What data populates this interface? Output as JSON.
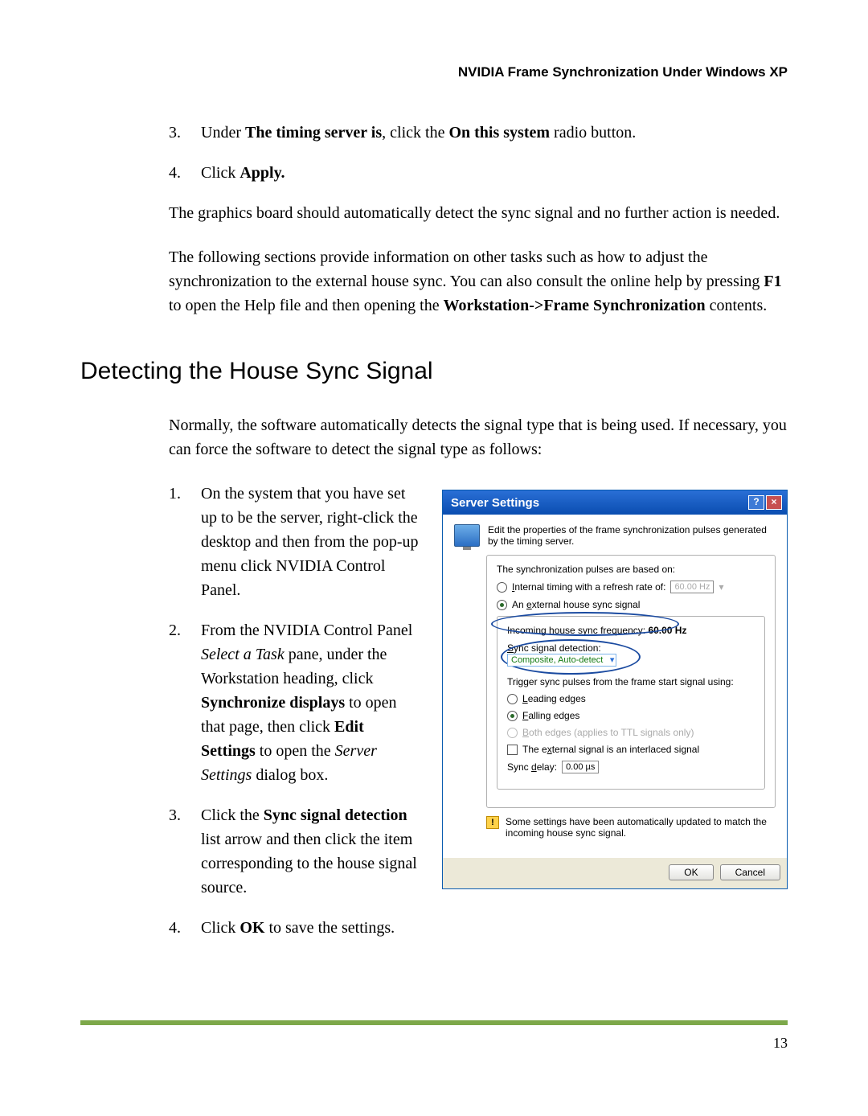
{
  "header": "NVIDIA Frame Synchronization Under Windows XP",
  "top_list": {
    "item3": {
      "num": "3.",
      "pre": "Under ",
      "b1": "The timing server is",
      "mid": ", click the ",
      "b2": "On this system",
      "post": " radio button."
    },
    "item4": {
      "num": "4.",
      "pre": "Click ",
      "b1": "Apply."
    }
  },
  "para1": "The graphics board should automatically detect the sync signal and no further action is needed.",
  "para2": {
    "t1": "The following sections provide information on other tasks such as how to adjust the synchronization to the external house sync. You can also consult the online help by pressing ",
    "b1": "F1",
    "t2": " to open the Help file and then opening the ",
    "b2": "Workstation->Frame Synchronization",
    "t3": " contents."
  },
  "section_heading": "Detecting the House Sync Signal",
  "para3": "Normally, the software automatically detects the signal type that is being used. If necessary, you can force the software to detect the signal type as follows:",
  "steps": {
    "s1": {
      "num": "1.",
      "text": "On the system that you have set up to be the server, right-click the desktop and then from the pop-up menu click NVIDIA Control Panel."
    },
    "s2": {
      "num": "2.",
      "pre": "From the NVIDIA Control Panel ",
      "i1": "Select a Task",
      "mid1": " pane, under the Workstation heading, click ",
      "b1": "Synchronize displays",
      "mid2": " to open that page, then click ",
      "b2": "Edit Settings",
      "mid3": " to open the ",
      "i2": "Server Settings",
      "post": " dialog box."
    },
    "s3": {
      "num": "3.",
      "pre": "Click the ",
      "b1": "Sync signal detection",
      "post": " list arrow and then click the item corresponding to the house signal source."
    },
    "s4": {
      "num": "4.",
      "pre": "Click ",
      "b1": "OK",
      "post": " to save the settings."
    }
  },
  "dialog": {
    "title": "Server Settings",
    "intro": "Edit the properties of the frame synchronization pulses generated by the timing server.",
    "pulses_label": "The synchronization pulses are based on:",
    "radio_internal_pre": "Internal timing with a refresh rate of:",
    "refresh_value": "60.00 Hz",
    "radio_external": "An external house sync signal",
    "freq_label_pre": "Incoming house sync frequency: ",
    "freq_value": "60.00 Hz",
    "sync_detect_label": "Sync signal detection:",
    "sync_detect_value": "Composite, Auto-detect",
    "trigger_label": "Trigger sync pulses from the frame start signal using:",
    "leading": "Leading edges",
    "falling": "Falling edges",
    "both": "Both edges (applies to TTL signals only)",
    "interlaced": "The external signal is an interlaced signal",
    "sync_delay_label": "Sync delay:",
    "sync_delay_value": "0.00 µs",
    "warning": "Some settings have been automatically updated to match the incoming house sync signal.",
    "ok": "OK",
    "cancel": "Cancel"
  },
  "page_num": "13"
}
